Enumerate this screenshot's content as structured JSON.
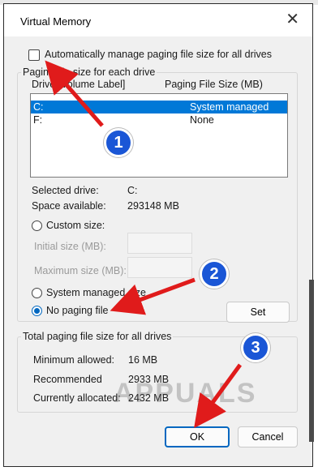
{
  "window": {
    "title": "Virtual Memory",
    "close_glyph": "✕"
  },
  "auto_manage": {
    "label": "Automatically manage paging file size for all drives",
    "checked": false
  },
  "paging_group": {
    "legend": "Paging file size for each drive",
    "columns": {
      "drive": "Drive [Volume Label]",
      "size": "Paging File Size (MB)"
    },
    "rows": [
      {
        "drive": "C:",
        "size": "System managed",
        "selected": true
      },
      {
        "drive": "F:",
        "size": "None",
        "selected": false
      }
    ],
    "selected_drive_label": "Selected drive:",
    "selected_drive_value": "C:",
    "space_label": "Space available:",
    "space_value": "293148 MB",
    "custom_size": "Custom size:",
    "initial_size": "Initial size (MB):",
    "max_size": "Maximum size (MB):",
    "system_managed": "System managed size",
    "no_paging": "No paging file",
    "set_button": "Set"
  },
  "total_group": {
    "legend": "Total paging file size for all drives",
    "min_label": "Minimum allowed:",
    "min_value": "16 MB",
    "rec_label": "Recommended",
    "rec_value": "2933 MB",
    "cur_label": "Currently allocated:",
    "cur_value": "2432 MB"
  },
  "buttons": {
    "ok": "OK",
    "cancel": "Cancel"
  },
  "markers": [
    "1",
    "2",
    "3"
  ],
  "watermark": "APPUALS",
  "colors": {
    "accent": "#0067c0",
    "selection": "#0078d7",
    "marker": "#1a56d6",
    "arrow": "#e01b1b"
  }
}
